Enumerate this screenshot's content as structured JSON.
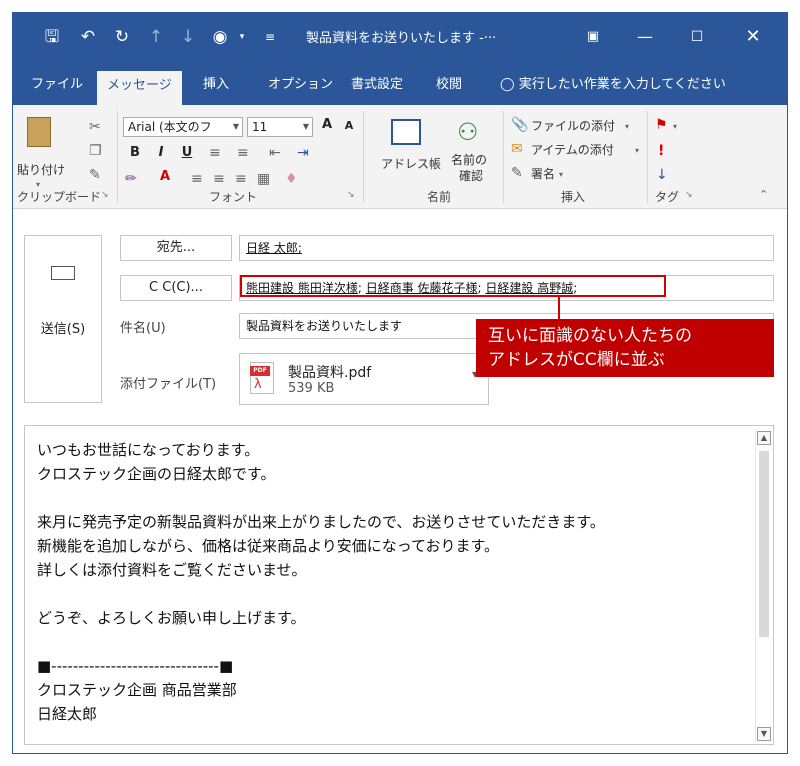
{
  "titlebar": {
    "title": "製品資料をお送りいたします -···",
    "icons": {
      "save": "save-icon",
      "undo": "undo-icon",
      "redo": "redo-icon",
      "up": "arrow-up-icon",
      "down": "arrow-down-icon",
      "customize": "quick-access-icon"
    }
  },
  "tabs": [
    "ファイル",
    "メッセージ",
    "挿入",
    "オプション",
    "書式設定",
    "校閲"
  ],
  "tellme": "実行したい作業を入力してください",
  "ribbon": {
    "clipboard": {
      "paste": "貼り付け",
      "group": "クリップボード"
    },
    "font": {
      "name": "Arial (本文のフ",
      "size": "11",
      "group": "フォント",
      "bold": "B",
      "italic": "I",
      "underline": "U",
      "grow": "A",
      "shrink": "A",
      "color_a": "A"
    },
    "names": {
      "addressbook": "アドレス帳",
      "check_line1": "名前の",
      "check_line2": "確認",
      "group": "名前"
    },
    "insert": {
      "attach_file": "ファイルの添付",
      "attach_item": "アイテムの添付",
      "signature": "署名",
      "group": "挿入"
    },
    "tags": {
      "group": "タグ"
    }
  },
  "header": {
    "send": "送信(S)",
    "to_button": "宛先...",
    "to_value": "日経 太郎;",
    "cc_button": "C C(C)...",
    "cc_names": [
      "熊田建設 熊田洋次様",
      "日経商事 佐藤花子様",
      "日経建設 高野誠"
    ],
    "cc_separator": "; ",
    "subject_label": "件名(U)",
    "subject_value": "製品資料をお送りいたします",
    "attach_label": "添付ファイル(T)",
    "attachment": {
      "name": "製品資料.pdf",
      "size": "539 KB",
      "badge": "PDF"
    }
  },
  "annotation": {
    "callout_line1": "互いに面識のない人たちの",
    "callout_line2": "アドレスがCC欄に並ぶ"
  },
  "body": {
    "lines": [
      "いつもお世話になっております。",
      "クロステック企画の日経太郎です。",
      "",
      "来月に発売予定の新製品資料が出来上がりましたので、お送りさせていただきます。",
      "新機能を追加しながら、価格は従来商品より安価になっております。",
      "詳しくは添付資料をご覧くださいませ。",
      "",
      "どうぞ、よろしくお願い申し上げます。",
      "",
      "■-------------------------------■",
      "クロステック企画 商品営業部",
      "日経太郎"
    ]
  },
  "colors": {
    "accent": "#2b579a",
    "callout": "#c00000",
    "highlight_border": "#d40000"
  }
}
